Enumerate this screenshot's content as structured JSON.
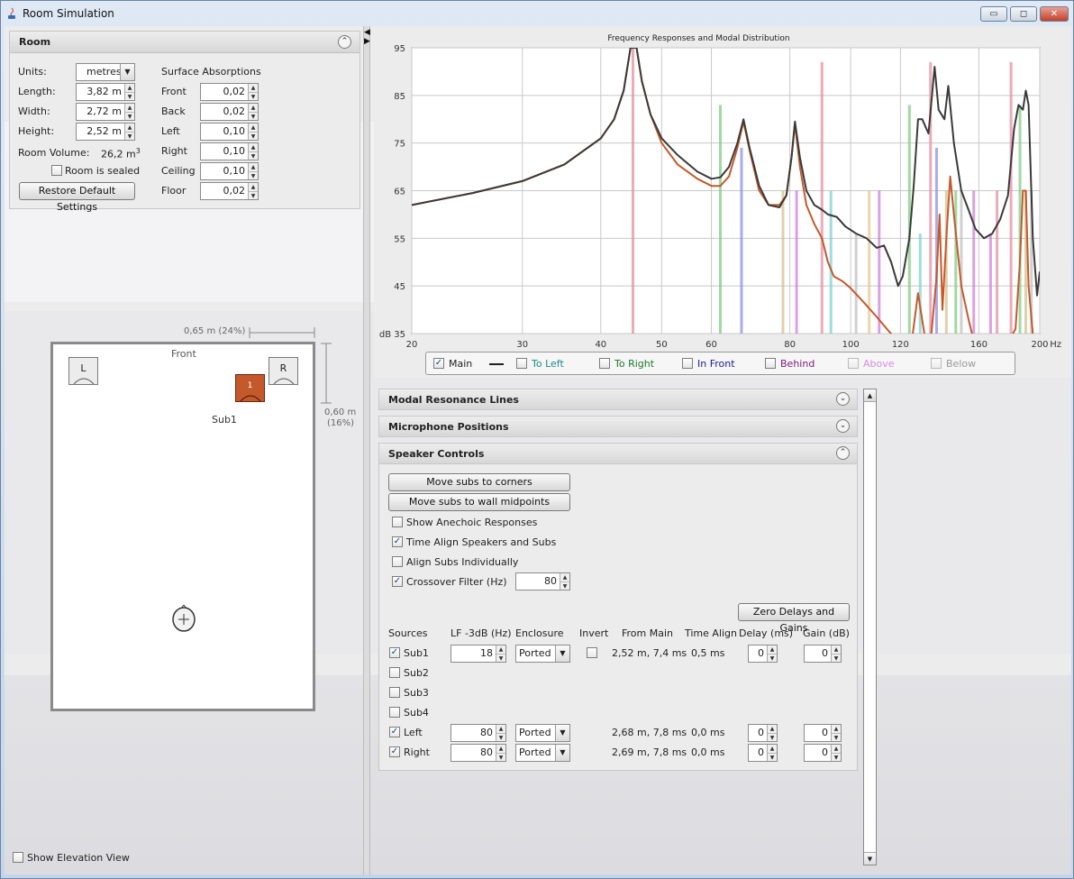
{
  "window": {
    "title": "Room Simulation",
    "controls": {
      "minimize": "▭",
      "maximize": "◻",
      "close": "✕"
    }
  },
  "room": {
    "header": "Room",
    "units_label": "Units:",
    "units_value": "metres",
    "length_label": "Length:",
    "length_value": "3,82 m",
    "width_label": "Width:",
    "width_value": "2,72 m",
    "height_label": "Height:",
    "height_value": "2,52 m",
    "volume_label": "Room Volume:",
    "volume_value": "26,2 m",
    "volume_sup": "3",
    "sealed_label": "Room is sealed",
    "sealed": false,
    "restore_button": "Restore Default Settings",
    "absorption_header": "Surface Absorptions",
    "absorptions": [
      {
        "label": "Front",
        "value": "0,02"
      },
      {
        "label": "Back",
        "value": "0,02"
      },
      {
        "label": "Left",
        "value": "0,10"
      },
      {
        "label": "Right",
        "value": "0,10"
      },
      {
        "label": "Ceiling",
        "value": "0,10"
      },
      {
        "label": "Floor",
        "value": "0,02"
      }
    ]
  },
  "plan": {
    "dim_x": "0,65 m (24%)",
    "dim_y_line1": "0,60 m",
    "dim_y_line2": "(16%)",
    "front_label": "Front",
    "speaker_left": "L",
    "speaker_right": "R",
    "sub_number": "1",
    "sub_label": "Sub1",
    "sub_color": "#c4592b",
    "elevation_label": "Show Elevation View",
    "elevation": false
  },
  "chart_data": {
    "type": "line",
    "title": "Frequency Responses and Modal Distribution",
    "x_scale": "log",
    "xlim": [
      20,
      200
    ],
    "ylim": [
      35,
      95
    ],
    "grid": true,
    "x_ticks": [
      {
        "v": 20,
        "label": "20"
      },
      {
        "v": 30,
        "label": "30"
      },
      {
        "v": 40,
        "label": "40"
      },
      {
        "v": 50,
        "label": "50"
      },
      {
        "v": 60,
        "label": "60"
      },
      {
        "v": 80,
        "label": "80"
      },
      {
        "v": 100,
        "label": "100"
      },
      {
        "v": 120,
        "label": "120"
      },
      {
        "v": 160,
        "label": "160"
      },
      {
        "v": 200,
        "label": "200"
      }
    ],
    "x_unit": "Hz",
    "y_ticks": [
      {
        "v": 95,
        "label": "95"
      },
      {
        "v": 85,
        "label": "85"
      },
      {
        "v": 75,
        "label": "75"
      },
      {
        "v": 65,
        "label": "65"
      },
      {
        "v": 55,
        "label": "55"
      },
      {
        "v": 45,
        "label": "45"
      },
      {
        "v": 35,
        "label": "dB 35"
      }
    ],
    "series": [
      {
        "name": "Main",
        "color": "#3a3a3a",
        "points": [
          [
            20,
            62
          ],
          [
            25,
            64.5
          ],
          [
            30,
            67
          ],
          [
            35,
            70.5
          ],
          [
            40,
            76
          ],
          [
            42,
            80
          ],
          [
            43.5,
            86
          ],
          [
            44.6,
            95
          ],
          [
            45.6,
            95
          ],
          [
            46.5,
            88
          ],
          [
            48,
            81
          ],
          [
            50,
            76
          ],
          [
            53,
            72.5
          ],
          [
            57,
            69
          ],
          [
            60,
            67.5
          ],
          [
            62,
            67.8
          ],
          [
            64,
            70
          ],
          [
            66,
            75
          ],
          [
            67.5,
            80
          ],
          [
            69,
            74
          ],
          [
            71.5,
            66
          ],
          [
            74,
            62
          ],
          [
            77,
            61.5
          ],
          [
            79,
            64
          ],
          [
            80.5,
            72
          ],
          [
            81.5,
            79.5
          ],
          [
            83,
            72
          ],
          [
            85,
            65
          ],
          [
            87.5,
            62
          ],
          [
            90,
            61
          ],
          [
            92,
            60
          ],
          [
            95,
            59.5
          ],
          [
            98,
            57.5
          ],
          [
            102,
            56
          ],
          [
            106,
            55
          ],
          [
            110,
            53
          ],
          [
            113,
            53.5
          ],
          [
            116,
            50
          ],
          [
            119,
            45
          ],
          [
            121,
            47
          ],
          [
            124,
            55
          ],
          [
            126,
            66
          ],
          [
            128,
            80
          ],
          [
            130,
            80
          ],
          [
            133,
            77
          ],
          [
            136,
            91
          ],
          [
            138,
            82
          ],
          [
            141,
            80
          ],
          [
            143,
            87
          ],
          [
            146,
            75
          ],
          [
            150,
            65
          ],
          [
            154,
            61
          ],
          [
            158,
            57
          ],
          [
            163,
            55
          ],
          [
            168,
            56
          ],
          [
            173,
            59
          ],
          [
            178,
            64
          ],
          [
            182,
            78
          ],
          [
            185,
            83
          ],
          [
            188,
            82
          ],
          [
            190,
            86
          ],
          [
            192,
            83
          ],
          [
            195,
            55
          ],
          [
            198,
            43
          ],
          [
            200,
            48
          ]
        ]
      },
      {
        "name": "To Left",
        "color": "#c4592b",
        "points": [
          [
            20,
            62
          ],
          [
            25,
            64.5
          ],
          [
            30,
            67
          ],
          [
            35,
            70.5
          ],
          [
            40,
            76
          ],
          [
            42,
            80
          ],
          [
            43.5,
            86
          ],
          [
            44.6,
            95
          ],
          [
            45.6,
            95
          ],
          [
            46.5,
            88
          ],
          [
            48,
            81
          ],
          [
            50,
            75
          ],
          [
            53,
            70.5
          ],
          [
            57,
            67.5
          ],
          [
            60,
            66
          ],
          [
            62,
            66
          ],
          [
            64,
            68
          ],
          [
            66,
            74
          ],
          [
            67.5,
            79.5
          ],
          [
            69,
            73.5
          ],
          [
            71.5,
            65
          ],
          [
            74,
            62
          ],
          [
            77,
            62
          ],
          [
            79,
            64
          ],
          [
            80.5,
            72
          ],
          [
            81.5,
            79
          ],
          [
            83,
            70
          ],
          [
            85,
            62
          ],
          [
            87.5,
            58
          ],
          [
            90,
            55
          ],
          [
            92,
            50
          ],
          [
            94,
            47
          ],
          [
            97,
            46
          ],
          [
            100,
            44.5
          ],
          [
            105,
            41.5
          ],
          [
            110,
            38.5
          ],
          [
            115,
            35.5
          ],
          [
            120,
            33
          ],
          [
            125,
            33
          ],
          [
            128,
            43.5
          ],
          [
            131,
            35
          ],
          [
            134,
            33
          ],
          [
            137,
            47
          ],
          [
            138.5,
            60
          ],
          [
            140,
            40
          ],
          [
            142,
            55
          ],
          [
            144,
            68
          ],
          [
            146,
            60
          ],
          [
            150,
            45
          ],
          [
            154,
            38
          ],
          [
            158,
            32
          ],
          [
            165,
            30
          ],
          [
            172,
            28
          ],
          [
            178,
            33
          ],
          [
            183,
            36
          ],
          [
            186,
            50
          ],
          [
            188,
            65
          ],
          [
            190,
            65
          ],
          [
            192,
            45
          ],
          [
            195,
            35
          ],
          [
            200,
            30
          ]
        ]
      }
    ],
    "modal_lines": [
      {
        "x": 45,
        "h": 95,
        "color": "#e48fa0"
      },
      {
        "x": 62,
        "h": 83,
        "color": "#7fcc84"
      },
      {
        "x": 67,
        "h": 74,
        "color": "#8f8fe8"
      },
      {
        "x": 78,
        "h": 65,
        "color": "#d4c090"
      },
      {
        "x": 82,
        "h": 65,
        "color": "#d080d8"
      },
      {
        "x": 90,
        "h": 92,
        "color": "#e48fa0"
      },
      {
        "x": 93,
        "h": 65,
        "color": "#80d0d0"
      },
      {
        "x": 102,
        "h": 56,
        "color": "#c0c0c0"
      },
      {
        "x": 107,
        "h": 65,
        "color": "#e8c890"
      },
      {
        "x": 111,
        "h": 65,
        "color": "#d080d8"
      },
      {
        "x": 124,
        "h": 83,
        "color": "#7fcc84"
      },
      {
        "x": 129,
        "h": 56,
        "color": "#80d0d0"
      },
      {
        "x": 134,
        "h": 92,
        "color": "#e48fa0"
      },
      {
        "x": 137,
        "h": 74,
        "color": "#8f8fe8"
      },
      {
        "x": 142,
        "h": 65,
        "color": "#d4c090"
      },
      {
        "x": 147,
        "h": 65,
        "color": "#7fcc84"
      },
      {
        "x": 150,
        "h": 65,
        "color": "#c0c0c0"
      },
      {
        "x": 157,
        "h": 65,
        "color": "#d080d8"
      },
      {
        "x": 167,
        "h": 56,
        "color": "#d080d8"
      },
      {
        "x": 171,
        "h": 65,
        "color": "#e48fa0"
      },
      {
        "x": 180,
        "h": 92,
        "color": "#e48fa0"
      },
      {
        "x": 186,
        "h": 83,
        "color": "#7fcc84"
      },
      {
        "x": 190,
        "h": 65,
        "color": "#d4c090"
      },
      {
        "x": 194,
        "h": 65,
        "color": "#c0c0c0"
      }
    ]
  },
  "legend": [
    {
      "label": "Main",
      "checked": true,
      "color": "#222222",
      "line": true
    },
    {
      "label": "To Left",
      "checked": false,
      "color": "#1c8a8a"
    },
    {
      "label": "To Right",
      "checked": false,
      "color": "#1d7a2a"
    },
    {
      "label": "In Front",
      "checked": false,
      "color": "#1a1a9a"
    },
    {
      "label": "Behind",
      "checked": false,
      "color": "#7a1a7a"
    },
    {
      "label": "Above",
      "checked": false,
      "color": "#d88ae0",
      "disabled": true
    },
    {
      "label": "Below",
      "checked": false,
      "color": "#9a9a9a",
      "disabled": true
    }
  ],
  "sections": {
    "modal": "Modal Resonance Lines",
    "mics": "Microphone Positions",
    "speakers": "Speaker Controls"
  },
  "speaker_controls": {
    "move_corners": "Move subs to corners",
    "move_midpoints": "Move subs to wall midpoints",
    "anechoic_label": "Show Anechoic Responses",
    "anechoic": false,
    "time_align_label": "Time Align Speakers and Subs",
    "time_align": true,
    "align_individually_label": "Align Subs Individually",
    "align_individually": false,
    "crossover_label": "Crossover Filter (Hz)",
    "crossover": true,
    "crossover_value": "80",
    "zero_button": "Zero Delays and Gains",
    "columns": [
      "Sources",
      "LF -3dB (Hz)",
      "Enclosure",
      "Invert",
      "From Main",
      "Time Align",
      "Delay (ms)",
      "Gain (dB)"
    ],
    "rows": [
      {
        "name": "Sub1",
        "checked": true,
        "lf": "18",
        "enclosure": "Ported",
        "invert": false,
        "from_main": "2,52 m, 7,4 ms",
        "time_align": "0,5 ms",
        "delay": "0",
        "gain": "0"
      },
      {
        "name": "Sub2",
        "checked": false
      },
      {
        "name": "Sub3",
        "checked": false
      },
      {
        "name": "Sub4",
        "checked": false
      },
      {
        "name": "Left",
        "checked": true,
        "lf": "80",
        "enclosure": "Ported",
        "from_main": "2,68 m, 7,8 ms",
        "time_align": "0,0 ms",
        "delay": "0",
        "gain": "0"
      },
      {
        "name": "Right",
        "checked": true,
        "lf": "80",
        "enclosure": "Ported",
        "from_main": "2,69 m, 7,8 ms",
        "time_align": "0,0 ms",
        "delay": "0",
        "gain": "0"
      }
    ]
  },
  "icons": {
    "collapse_up": "collapse-up-icon",
    "collapse_down": "collapse-down-icon",
    "listener": "listener-icon",
    "java": "java-icon"
  }
}
